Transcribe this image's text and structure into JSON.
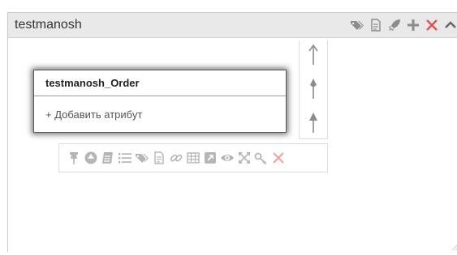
{
  "panel": {
    "title": "testmanosh",
    "header_tools": [
      "tags-icon",
      "document-icon",
      "rocket-icon",
      "plus-icon",
      "close-icon",
      "chevron-up-icon"
    ]
  },
  "entity": {
    "title": "testmanosh_Order",
    "add_attribute_label": "+ Добавить атрибут"
  },
  "toolbar": {
    "icons": [
      "pin-icon",
      "circle-arrow-icon",
      "notepad-icon",
      "list-icon",
      "tags-icon",
      "document-icon",
      "link-icon",
      "table-icon",
      "external-icon",
      "eye-icon",
      "expand-icon",
      "key-icon",
      "close-icon"
    ]
  },
  "colors": {
    "header_bg": "#e9e9e9",
    "icon_gray": "#8c8c8c",
    "icon_light": "#b5b5b5",
    "close_red": "#e05252",
    "close_light_red": "#f2a0a0"
  }
}
